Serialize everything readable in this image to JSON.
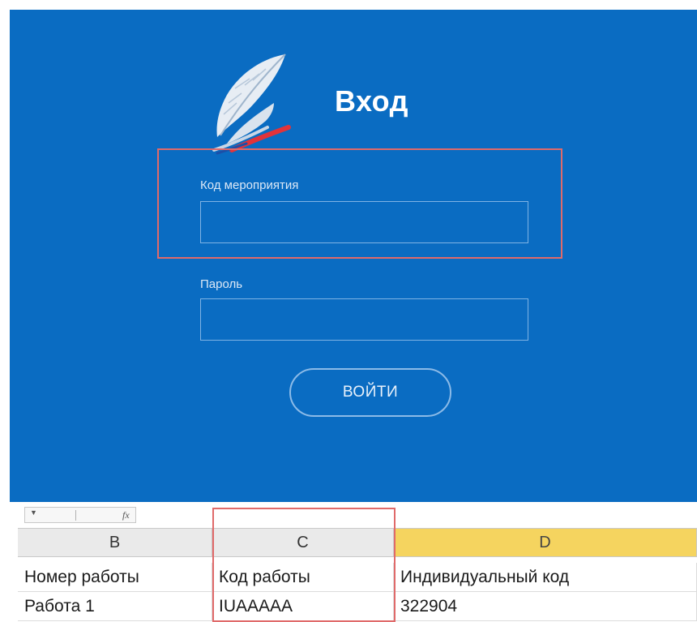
{
  "login": {
    "title": "Вход",
    "event_code_label": "Код мероприятия",
    "event_code_value": "",
    "password_label": "Пароль",
    "password_value": "",
    "submit_label": "ВОЙТИ"
  },
  "colors": {
    "panel_background": "#0a6cc2",
    "highlight_border": "#e06a6a",
    "selected_column": "#f5d45f"
  },
  "spreadsheet": {
    "columns": [
      "B",
      "C",
      "D"
    ],
    "selected_column": "D",
    "rows": [
      [
        "Номер работы",
        "Код работы",
        "Индивидуальный код"
      ],
      [
        "Работа 1",
        "IUAAAAA",
        "322904"
      ]
    ]
  }
}
